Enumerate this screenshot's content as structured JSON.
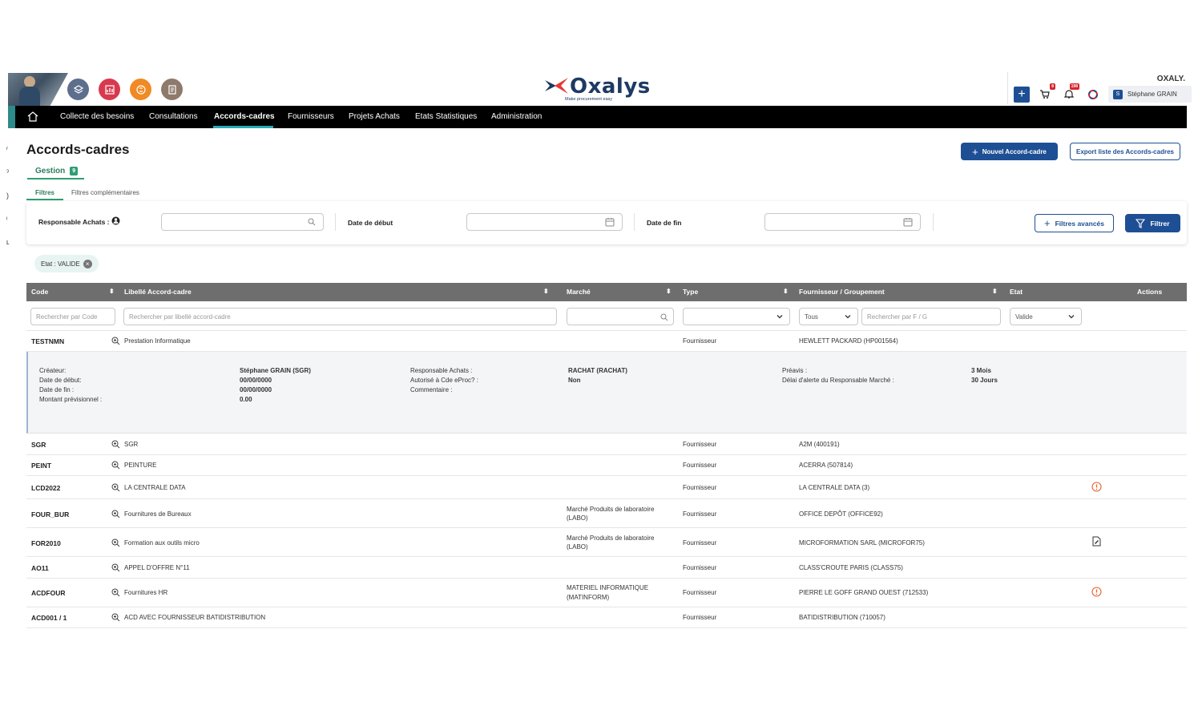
{
  "header": {
    "org": "OXALY.",
    "logo_word": "Oxalys",
    "logo_tagline": "Make procurement easy",
    "notif_cart": "8",
    "notif_bell": "198",
    "user_initial": "S",
    "user_name": "Stéphane GRAIN"
  },
  "nav": {
    "items": [
      "Collecte des besoins",
      "Consultations",
      "Accords-cadres",
      "Fournisseurs",
      "Projets Achats",
      "Etats Statistiques",
      "Administration"
    ],
    "active": "Accords-cadres"
  },
  "page": {
    "title": "Accords-cadres",
    "tab_label": "Gestion",
    "tab_count": "9",
    "btn_new": "Nouvel Accord-cadre",
    "btn_export": "Export liste des Accords-cadres",
    "subtab_filters": "Filtres",
    "subtab_more": "Filtres complémentaires"
  },
  "filters": {
    "resp_label": "Responsable Achats :",
    "start_label": "Date de début",
    "end_label": "Date de fin",
    "btn_advanced": "Filtres avancés",
    "btn_filter": "Filtrer",
    "chip": "Etat : VALIDE"
  },
  "table": {
    "headers": {
      "code": "Code",
      "libelle": "Libellé Accord-cadre",
      "marche": "Marché",
      "type": "Type",
      "fournisseur": "Fournisseur / Groupement",
      "etat": "Etat",
      "actions": "Actions"
    },
    "search": {
      "code_placeholder": "Rechercher par Code",
      "libelle_placeholder": "Rechercher par libellé accord-cadre",
      "fournisseur_mode": "Tous",
      "fournisseur_placeholder": "Rechercher par F / G",
      "etat_value": "Valide"
    },
    "rows": [
      {
        "code": "TESTNMN",
        "libelle": "Prestation Informatique",
        "marche": "",
        "type": "Fournisseur",
        "fournisseur": "HEWLETT PACKARD (HP001564)",
        "action": ""
      },
      {
        "code": "SGR",
        "libelle": "SGR",
        "marche": "",
        "type": "Fournisseur",
        "fournisseur": "A2M (400191)",
        "action": ""
      },
      {
        "code": "PEINT",
        "libelle": "PEINTURE",
        "marche": "",
        "type": "Fournisseur",
        "fournisseur": "ACERRA (507814)",
        "action": ""
      },
      {
        "code": "LCD2022",
        "libelle": "LA CENTRALE DATA",
        "marche": "",
        "type": "Fournisseur",
        "fournisseur": "LA CENTRALE DATA (3)",
        "action": "alert"
      },
      {
        "code": "FOUR_BUR",
        "libelle": "Fournitures de Bureaux",
        "marche": "Marché Produits de laboratoire",
        "marche2": "(LABO)",
        "type": "Fournisseur",
        "fournisseur": "OFFICE DEPÔT (OFFICE92)",
        "action": ""
      },
      {
        "code": "FOR2010",
        "libelle": "Formation aux outils micro",
        "marche": "Marché Produits de laboratoire",
        "marche2": "(LABO)",
        "type": "Fournisseur",
        "fournisseur": "MICROFORMATION SARL (MICROFOR75)",
        "action": "doc"
      },
      {
        "code": "AO11",
        "libelle": "APPEL D'OFFRE N°11",
        "marche": "",
        "type": "Fournisseur",
        "fournisseur": "CLASS'CROUTE PARIS (CLASS75)",
        "action": ""
      },
      {
        "code": "ACDFOUR",
        "libelle": "Fournitures HR",
        "marche": "MATERIEL INFORMATIQUE",
        "marche2": "(MATINFORM)",
        "type": "Fournisseur",
        "fournisseur": "PIERRE LE GOFF GRAND OUEST (712533)",
        "action": "alert"
      },
      {
        "code": "ACD001 / 1",
        "libelle": "ACD AVEC FOURNISSEUR BATIDISTRIBUTION",
        "marche": "",
        "type": "Fournisseur",
        "fournisseur": "BATIDISTRIBUTION (710057)",
        "action": ""
      }
    ],
    "detail": {
      "l1": "Créateur:",
      "l2": "Date de début:",
      "l3": "Date de fin :",
      "l4": "Montant prévisionnel :",
      "v1": "Stéphane GRAIN (SGR)",
      "v2": "00/00/0000",
      "v3": "00/00/0000",
      "v4": "0.00",
      "m1": "Responsable Achats :",
      "m2": "Autorisé à Cde eProc? :",
      "m3": "Commentaire :",
      "mv1": "RACHAT (RACHAT)",
      "mv2": "Non",
      "r1": "Préavis :",
      "r2": "Délai d'alerte du Responsable Marché :",
      "rv1": "3 Mois",
      "rv2": "30 Jours"
    }
  },
  "colors": {
    "nav_bg": "#000000",
    "accent_teal": "#2e8a8b",
    "primary_blue": "#1e4f94",
    "header_gray": "#6e6e6e",
    "alert_orange": "#e8622a",
    "green": "#2e9e73"
  }
}
